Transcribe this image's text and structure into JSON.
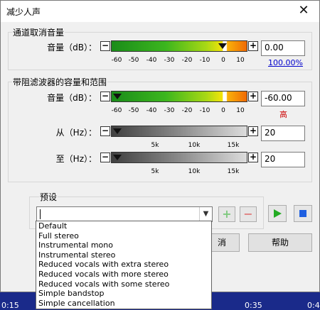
{
  "window": {
    "title": "减少人声",
    "close_glyph": "✕"
  },
  "group1": {
    "title": "通道取消音量",
    "row_label": "音量（dB）：",
    "minus": "−",
    "plus": "+",
    "ticks": [
      "-60",
      "-50",
      "-40",
      "-30",
      "-20",
      "-10",
      "0",
      "10"
    ],
    "value": "0.00",
    "link": "100.00%"
  },
  "group2": {
    "title": "带阻滤波器的容量和范围",
    "volume": {
      "label": "音量（dB）：",
      "ticks": [
        "-60",
        "-50",
        "-40",
        "-30",
        "-20",
        "-10",
        "0",
        "10"
      ],
      "value": "-60.00",
      "warning": "高"
    },
    "from": {
      "label": "从（Hz）：",
      "ticks": [
        "5k",
        "10k",
        "15k"
      ],
      "value": "20"
    },
    "to": {
      "label": "至（Hz）：",
      "ticks": [
        "5k",
        "10k",
        "15k"
      ],
      "value": "20"
    }
  },
  "preset": {
    "title": "预设",
    "input_value": "",
    "add_glyph": "+",
    "remove_glyph": "−",
    "options": [
      "Default",
      "Full stereo",
      "Instrumental mono",
      "Instrumental stereo",
      "Reduced vocals with extra stereo",
      "Reduced vocals with more stereo",
      "Reduced vocals with some stereo",
      "Simple bandstop",
      "Simple cancellation"
    ]
  },
  "buttons": {
    "cancel_partial": "消",
    "help": "帮助"
  },
  "background": {
    "time1": "0:15",
    "time2": "0:35",
    "time3": "0:4"
  },
  "colors": {
    "play": "#22aa22",
    "stop": "#1e5fe0",
    "add": "#7fc97f",
    "remove": "#e08080",
    "warning": "#cc0000",
    "link": "#0000cc"
  }
}
